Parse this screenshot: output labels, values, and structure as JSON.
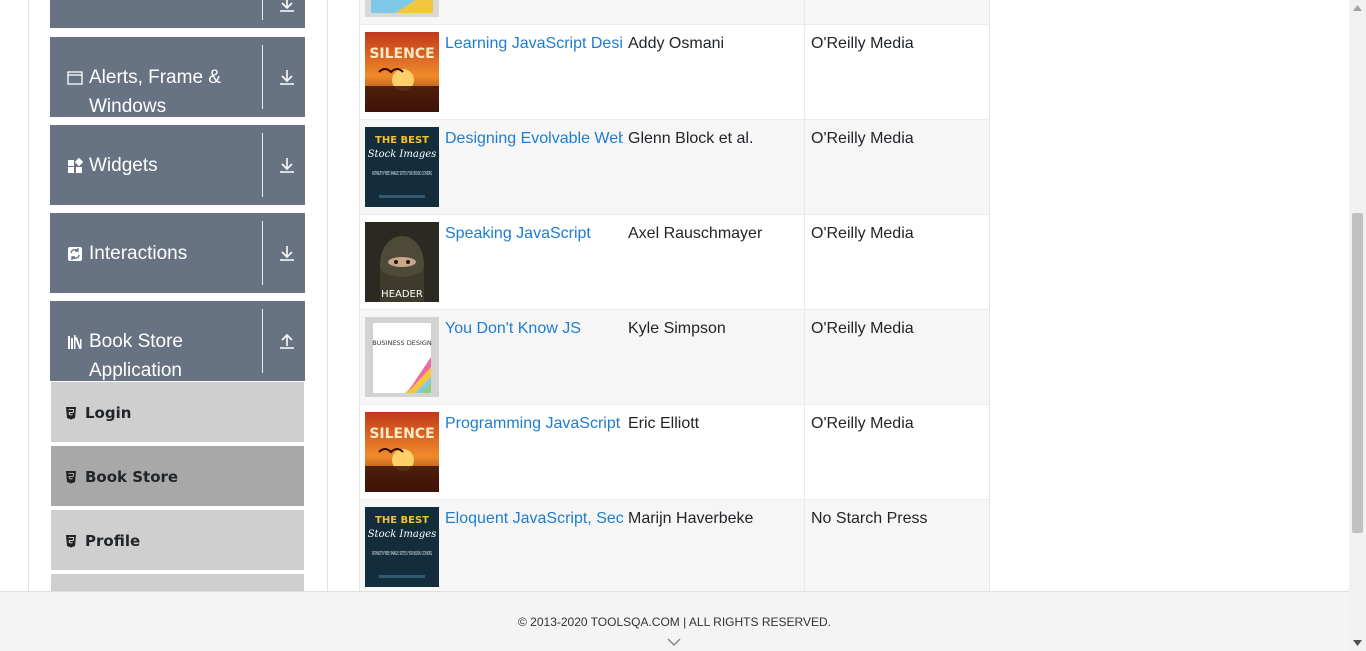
{
  "sidebar": {
    "groups": [
      {
        "title": "",
        "icon": "collapsed-group-icon",
        "expanded": false
      },
      {
        "title": "Alerts, Frame & Windows",
        "icon": "window-icon",
        "expanded": false
      },
      {
        "title": "Widgets",
        "icon": "widgets-icon",
        "expanded": false
      },
      {
        "title": "Interactions",
        "icon": "interactions-icon",
        "expanded": false
      },
      {
        "title": "Book Store Application",
        "icon": "books-icon",
        "expanded": true
      }
    ],
    "book_store_items": [
      {
        "label": "Login",
        "icon": "html5-icon",
        "active": false
      },
      {
        "label": "Book Store",
        "icon": "html5-icon",
        "active": true
      },
      {
        "label": "Profile",
        "icon": "html5-icon",
        "active": false
      },
      {
        "label": "",
        "icon": "html5-icon",
        "active": false
      }
    ]
  },
  "books": [
    {
      "title": "Learning JavaScript Design Patterns",
      "author": "Addy Osmani",
      "publisher": "O'Reilly Media",
      "cover": "silence"
    },
    {
      "title": "Designing Evolvable Web APIs with ASP.NET",
      "author": "Glenn Block et al.",
      "publisher": "O'Reilly Media",
      "cover": "best-stock"
    },
    {
      "title": "Speaking JavaScript",
      "author": "Axel Rauschmayer",
      "publisher": "O'Reilly Media",
      "cover": "header"
    },
    {
      "title": "You Don't Know JS",
      "author": "Kyle Simpson",
      "publisher": "O'Reilly Media",
      "cover": "business"
    },
    {
      "title": "Programming JavaScript Applications",
      "author": "Eric Elliott",
      "publisher": "O'Reilly Media",
      "cover": "silence"
    },
    {
      "title": "Eloquent JavaScript, Second Edition",
      "author": "Marijn Haverbeke",
      "publisher": "No Starch Press",
      "cover": "best-stock"
    }
  ],
  "cover_text": {
    "silence": "SILENCE",
    "best_top": "THE BEST",
    "best_script": "Stock Images",
    "best_sub": "ROYALTY-FREE IMAGE SITES FOR BOOK COVERS",
    "header": "HEADER",
    "business": "BUSINESS DESIGN"
  },
  "footer": {
    "copyright": "© 2013-2020 TOOLSQA.COM | ALL RIGHTS RESERVED."
  },
  "colors": {
    "sidebar_group": "#677383",
    "link": "#1d7dd1",
    "active_item": "#a8a8a8",
    "item": "#cfcfcf"
  }
}
